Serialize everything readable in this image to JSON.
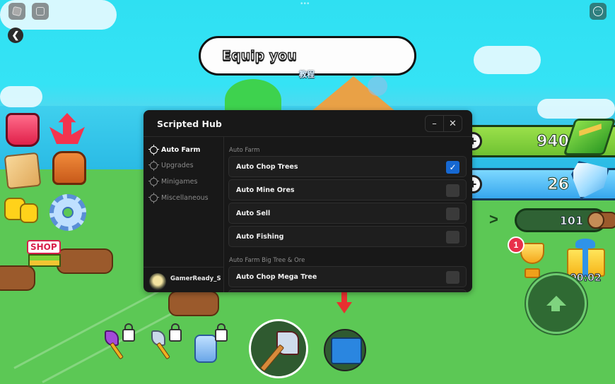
{
  "top_bar": {
    "roblox_menu_icon": "roblox-logo-icon",
    "chat_icon": "chat-icon",
    "back_icon": "back-icon",
    "back_glyph": "❮",
    "more_icon": "more-options-icon",
    "more_glyph": "···",
    "drag_handle": "•••"
  },
  "tutorial": {
    "bubble_text": "Equip you",
    "tag": "教程"
  },
  "currencies": {
    "cash": {
      "value": "940",
      "plus": "+"
    },
    "gems": {
      "value": "26",
      "plus": "+"
    },
    "wood": {
      "value": "101",
      "expand": ">"
    }
  },
  "rewards": {
    "trophy_badge": "1",
    "gift_timer": "00:02"
  },
  "left_menu": {
    "shop_label": "SHOP",
    "items": [
      "store",
      "upgrades",
      "quests-map",
      "inventory",
      "friends",
      "settings",
      "shop"
    ]
  },
  "hotbar": {
    "slots": [
      {
        "name": "purple-axe",
        "locked": true
      },
      {
        "name": "silver-axe",
        "locked": true
      },
      {
        "name": "robot-pet",
        "locked": true
      },
      {
        "name": "equipped-axe",
        "locked": false
      },
      {
        "name": "blueprint",
        "locked": false
      }
    ]
  },
  "hub": {
    "title": "Scripted Hub",
    "minimize": "–",
    "close": "✕",
    "nav": [
      {
        "label": "Auto Farm",
        "active": true
      },
      {
        "label": "Upgrades",
        "active": false
      },
      {
        "label": "Minigames",
        "active": false
      },
      {
        "label": "Miscellaneous",
        "active": false
      }
    ],
    "user": {
      "name": "GamerReady_Sc"
    },
    "sections": [
      {
        "label": "Auto Farm",
        "options": [
          {
            "label": "Auto Chop Trees",
            "checked": true
          },
          {
            "label": "Auto Mine Ores",
            "checked": false
          },
          {
            "label": "Auto Sell",
            "checked": false
          },
          {
            "label": "Auto Fishing",
            "checked": false
          }
        ]
      },
      {
        "label": "Auto Farm Big Tree & Ore",
        "options": [
          {
            "label": "Auto Chop Mega Tree",
            "checked": false
          }
        ]
      }
    ],
    "check_glyph": "✓",
    "colors": {
      "accent": "#1668d2",
      "panel": "#181818"
    }
  }
}
